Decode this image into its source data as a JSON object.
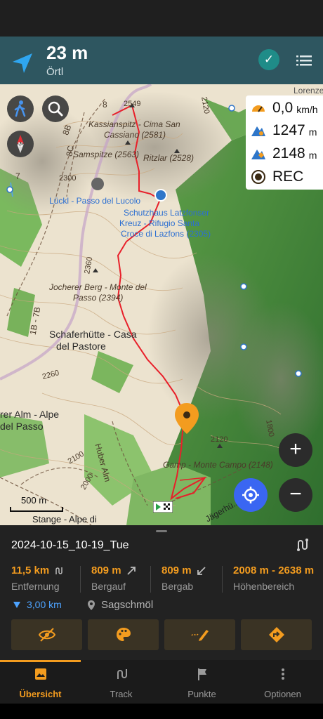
{
  "colors": {
    "accent": "#f39c1f",
    "header": "#2e5660",
    "route": "#e8202a",
    "blue": "#4da3ff"
  },
  "nav": {
    "distance": "23 m",
    "street": "Örtl"
  },
  "map": {
    "labels": {
      "peak1": "Kassianspitz - Cima San",
      "peak1b": "Cassiano (2581)",
      "samspitze": "Samspitze (2563)",
      "ritzlar": "Ritzlar (2528)",
      "luckl": "Lückl - Passo del Lucolo",
      "hut1": "Schutzhaus Latzfonser",
      "hut2": "Kreuz - Rifugio Santa",
      "hut3": "Croce di Lazfons (2305)",
      "jocherer1": "Jocherer Berg - Monte del",
      "jocherer2": "Passo (2394)",
      "schafer1": "Schaferhütte - Casa",
      "schafer2": "del Pastore",
      "alm1": "rer Alm - Alpe",
      "alm2": "del Passo",
      "huber": "Huber Alm",
      "gamp": "Gamp - Monte Campo (2148)",
      "stange": "Stange - Alpe di",
      "jager": "Jägerhü...",
      "lorenz": "Lorenze",
      "e2549": "2549",
      "e2120": "2120",
      "e2300": "2300",
      "e2360": "2360",
      "e2260": "2260",
      "e2100": "2100",
      "e2000": "2000",
      "e1800": "1800",
      "e2120b": "2120",
      "t8": "8",
      "t8B": "8B",
      "t8C": "8C",
      "t7": "7",
      "t7B": "1B - 7B"
    },
    "scale": "500 m",
    "info": {
      "speed": "0,0",
      "speed_unit": "km/h",
      "ascent": "1247",
      "ascent_unit": "m",
      "altitude": "2148",
      "altitude_unit": "m",
      "rec": "REC"
    }
  },
  "track": {
    "title": "2024-10-15_10-19_Tue",
    "stats": [
      {
        "value": "11,5 km",
        "label": "Entfernung"
      },
      {
        "value": "809 m",
        "label": "Bergauf"
      },
      {
        "value": "809 m",
        "label": "Bergab"
      },
      {
        "value": "2008 m - 2638 m",
        "label": "Höhenbereich"
      }
    ],
    "distance_to": "3,00 km",
    "place": "Sagschmöl"
  },
  "tabs": [
    {
      "label": "Übersicht"
    },
    {
      "label": "Track"
    },
    {
      "label": "Punkte"
    },
    {
      "label": "Optionen"
    }
  ]
}
